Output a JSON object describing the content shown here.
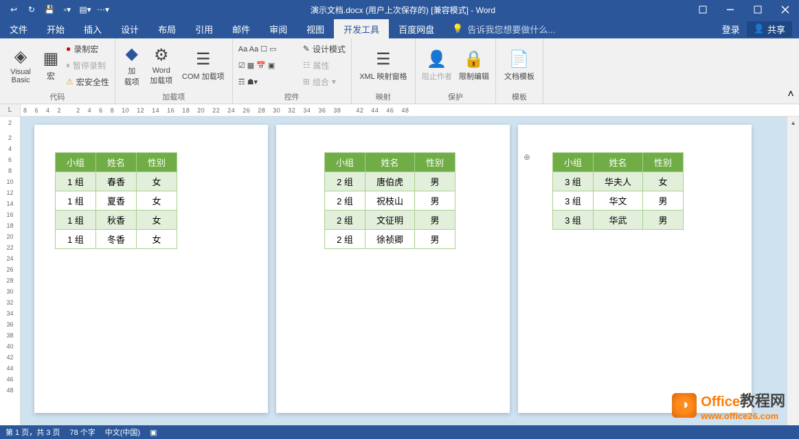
{
  "titlebar": {
    "doc_title": "演示文档.docx (用户上次保存的) [兼容模式] - Word"
  },
  "tabs": {
    "file": "文件",
    "home": "开始",
    "insert": "插入",
    "design": "设计",
    "layout": "布局",
    "references": "引用",
    "mailings": "邮件",
    "review": "审阅",
    "view": "视图",
    "developer": "开发工具",
    "baidu": "百度网盘",
    "tell_me": "告诉我您想要做什么...",
    "login": "登录",
    "share": "共享"
  },
  "ribbon": {
    "code": {
      "visual_basic": "Visual Basic",
      "macros": "宏",
      "record_macro": "录制宏",
      "pause_recording": "暂停录制",
      "macro_security": "宏安全性",
      "group_label": "代码"
    },
    "addins": {
      "addins": "加\n载项",
      "word_addins": "Word\n加载项",
      "com_addins": "COM 加载项",
      "group_label": "加载项"
    },
    "controls": {
      "design_mode": "设计模式",
      "properties": "属性",
      "group": "组合",
      "group_label": "控件"
    },
    "mapping": {
      "xml": "XML 映射窗格",
      "group_label": "映射"
    },
    "protect": {
      "block_authors": "阻止作者",
      "restrict_editing": "限制编辑",
      "group_label": "保护"
    },
    "templates": {
      "doc_template": "文档模板",
      "group_label": "模板"
    }
  },
  "ruler_h": [
    "8",
    "6",
    "4",
    "2",
    "",
    "2",
    "4",
    "6",
    "8",
    "10",
    "12",
    "14",
    "16",
    "18",
    "20",
    "22",
    "24",
    "26",
    "28",
    "30",
    "32",
    "34",
    "36",
    "38",
    "",
    "42",
    "44",
    "46",
    "48"
  ],
  "ruler_v": [
    "2",
    "",
    "2",
    "4",
    "6",
    "8",
    "10",
    "12",
    "14",
    "16",
    "18",
    "20",
    "22",
    "24",
    "26",
    "28",
    "30",
    "32",
    "34",
    "36",
    "38",
    "40",
    "42",
    "44",
    "46",
    "48"
  ],
  "tables": {
    "headers": [
      "小组",
      "姓名",
      "性别"
    ],
    "page1": [
      [
        "1 组",
        "春香",
        "女"
      ],
      [
        "1 组",
        "夏香",
        "女"
      ],
      [
        "1 组",
        "秋香",
        "女"
      ],
      [
        "1 组",
        "冬香",
        "女"
      ]
    ],
    "page2": [
      [
        "2 组",
        "唐伯虎",
        "男"
      ],
      [
        "2 组",
        "祝枝山",
        "男"
      ],
      [
        "2 组",
        "文征明",
        "男"
      ],
      [
        "2 组",
        "徐祯卿",
        "男"
      ]
    ],
    "page3": [
      [
        "3 组",
        "华夫人",
        "女"
      ],
      [
        "3 组",
        "华文",
        "男"
      ],
      [
        "3 组",
        "华武",
        "男"
      ]
    ]
  },
  "statusbar": {
    "page_info": "第 1 页，共 3 页",
    "word_count": "78 个字",
    "language": "中文(中国)"
  },
  "watermark": {
    "brand1": "Office",
    "brand2": "教程网",
    "url": "www.office26.com"
  }
}
